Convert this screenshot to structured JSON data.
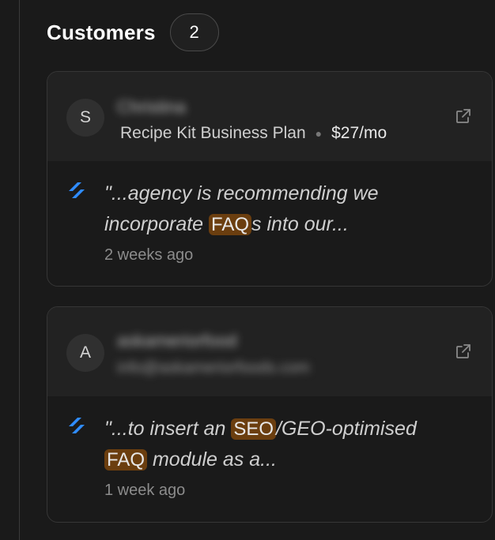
{
  "header": {
    "title": "Customers",
    "count": "2"
  },
  "customers": [
    {
      "avatar_initial": "S",
      "name_redacted": "Christina",
      "plan": "Recipe Kit Business Plan",
      "price": "$27/mo",
      "quote": {
        "before": "\"...agency is recommending we incorporate ",
        "highlight": "FAQ",
        "after": "s into our..."
      },
      "time": "2 weeks ago"
    },
    {
      "avatar_initial": "A",
      "name_redacted": "askameriorfood",
      "email_redacted": "info@askameriorfoods.com",
      "quote": {
        "before": "\"...to insert an ",
        "highlight1": "SEO",
        "middle": "/GEO-optimised ",
        "highlight2": "FAQ",
        "after": " module as a..."
      },
      "time": "1 week ago"
    }
  ],
  "icons": {
    "external_link": "external-link-icon",
    "source": "stripe-slash-icon"
  },
  "colors": {
    "highlight": "#6b3e0f",
    "source_icon": "#2f8cff"
  }
}
